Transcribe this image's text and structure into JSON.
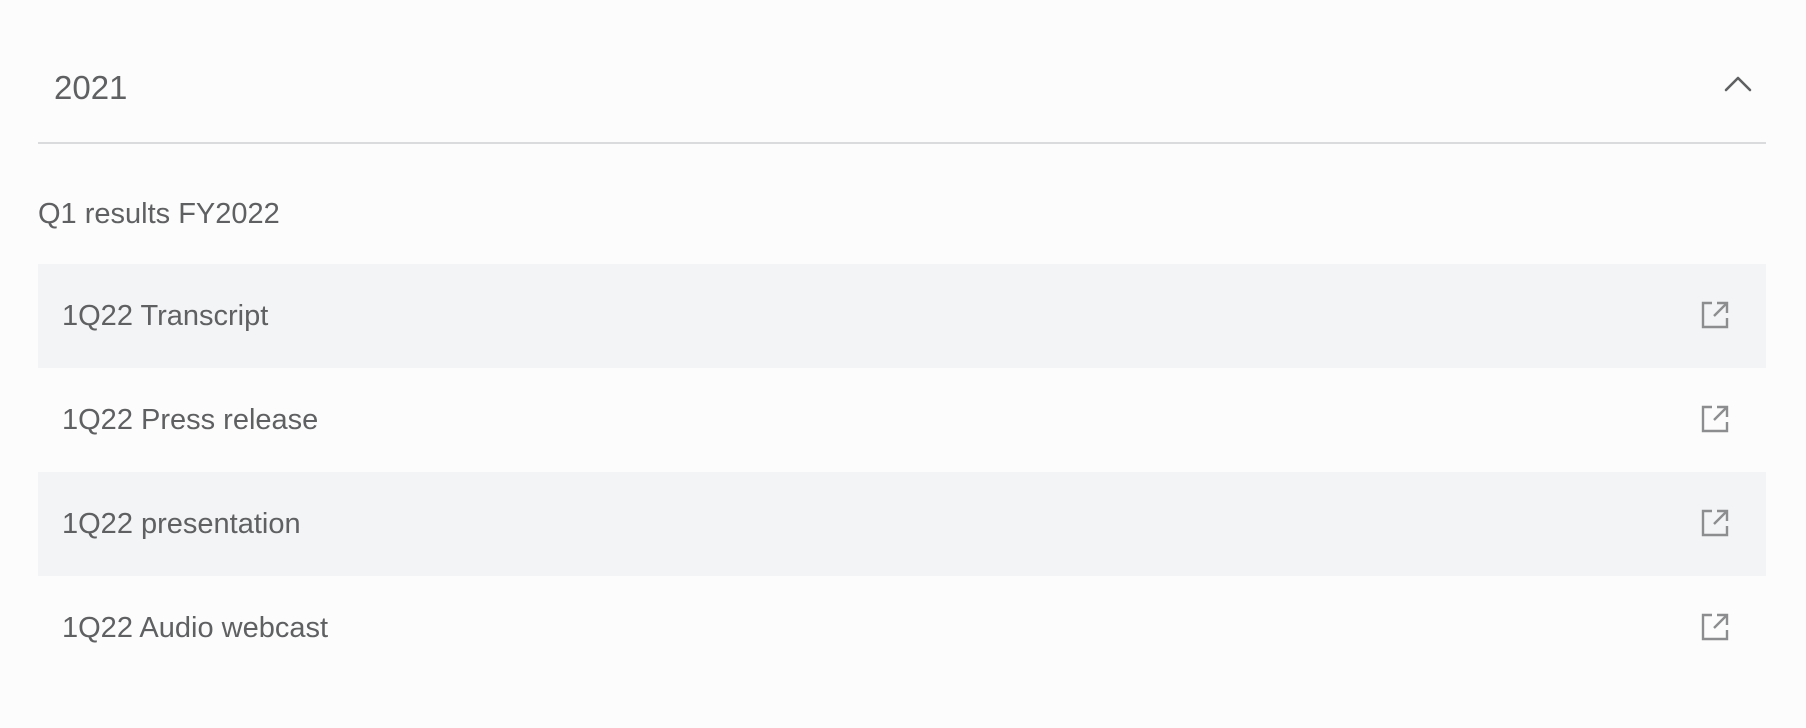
{
  "accordion": {
    "year": "2021",
    "toggle_icon": "chevron-up-icon",
    "section_title": "Q1 results FY2022",
    "items": [
      {
        "label": "1Q22 Transcript",
        "icon": "external-link-icon"
      },
      {
        "label": "1Q22 Press release",
        "icon": "external-link-icon"
      },
      {
        "label": "1Q22 presentation",
        "icon": "external-link-icon"
      },
      {
        "label": "1Q22 Audio webcast",
        "icon": "external-link-icon"
      }
    ]
  },
  "colors": {
    "background": "#fcfcfc",
    "row_shade": "#f3f4f6",
    "text": "#5f6062",
    "divider": "#dadbdc",
    "icon": "#8c8d8f"
  }
}
